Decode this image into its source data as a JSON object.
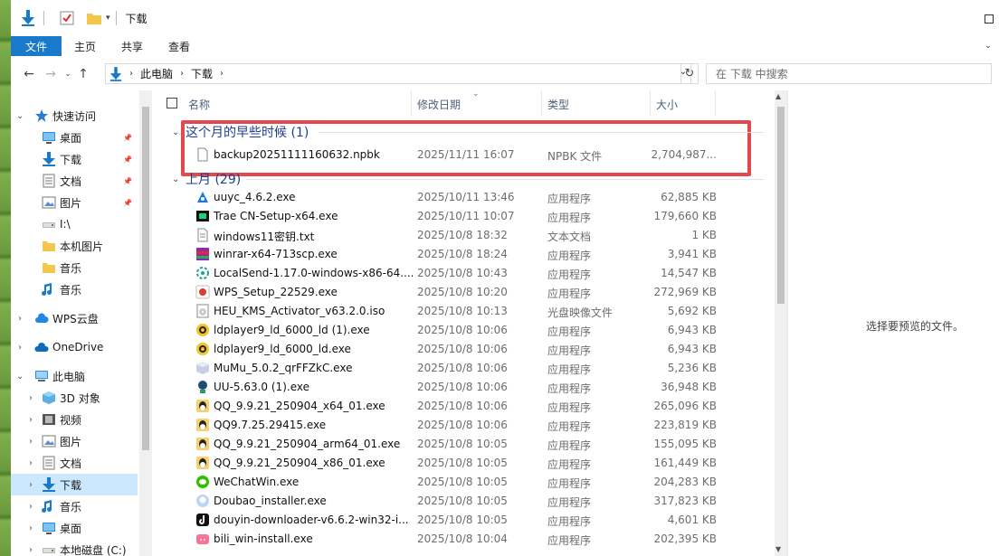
{
  "title": "下载",
  "ribbon": {
    "tabs": [
      "文件",
      "主页",
      "共享",
      "查看"
    ]
  },
  "address": {
    "crumbs": [
      "此电脑",
      "下载"
    ]
  },
  "search": {
    "placeholder": "在 下载 中搜索"
  },
  "nav": {
    "items": [
      {
        "label": "快速访问",
        "icon": "star-icon",
        "arrow": "expanded"
      },
      {
        "label": "桌面",
        "icon": "desktop-icon",
        "pinned": true
      },
      {
        "label": "下载",
        "icon": "download-arrow-icon",
        "pinned": true
      },
      {
        "label": "文档",
        "icon": "document-icon",
        "pinned": true
      },
      {
        "label": "图片",
        "icon": "picture-icon",
        "pinned": true
      },
      {
        "label": "I:\\",
        "icon": "drive-icon"
      },
      {
        "label": "本机图片",
        "icon": "folder-icon"
      },
      {
        "label": "音乐",
        "icon": "folder-icon"
      },
      {
        "label": "音乐",
        "icon": "music-icon"
      },
      {
        "label": "WPS云盘",
        "icon": "cloud-icon",
        "arrow": "collapsed"
      },
      {
        "label": "OneDrive",
        "icon": "onedrive-cloud-icon",
        "arrow": "collapsed"
      },
      {
        "label": "此电脑",
        "icon": "computer-icon",
        "arrow": "expanded"
      },
      {
        "label": "3D 对象",
        "icon": "cube-icon",
        "arrow": "collapsed"
      },
      {
        "label": "视频",
        "icon": "video-icon",
        "arrow": "collapsed"
      },
      {
        "label": "图片",
        "icon": "picture-icon",
        "arrow": "collapsed"
      },
      {
        "label": "文档",
        "icon": "document-icon",
        "arrow": "collapsed"
      },
      {
        "label": "下载",
        "icon": "download-arrow-icon",
        "arrow": "collapsed",
        "selected": true
      },
      {
        "label": "音乐",
        "icon": "music-icon",
        "arrow": "collapsed"
      },
      {
        "label": "桌面",
        "icon": "desktop-icon",
        "arrow": "collapsed"
      },
      {
        "label": "本地磁盘 (C:)",
        "icon": "drive-icon",
        "arrow": "collapsed"
      }
    ]
  },
  "columns": {
    "name": "名称",
    "date": "修改日期",
    "type": "类型",
    "size": "大小"
  },
  "groups": [
    {
      "label": "这个月的早些时候 (1)",
      "files": [
        {
          "name": "backup20251111160632.npbk",
          "date": "2025/11/11 16:07",
          "type": "NPBK 文件",
          "size": "2,704,987...",
          "icon": "blank-file-icon"
        }
      ]
    },
    {
      "label": "上月 (29)",
      "files": [
        {
          "name": "uuyc_4.6.2.exe",
          "date": "2025/10/11 13:46",
          "type": "应用程序",
          "size": "62,885 KB",
          "icon": "uuyc-app-icon"
        },
        {
          "name": "Trae CN-Setup-x64.exe",
          "date": "2025/10/11 10:07",
          "type": "应用程序",
          "size": "179,660 KB",
          "icon": "trae-app-icon"
        },
        {
          "name": "windows11密钥.txt",
          "date": "2025/10/8 18:32",
          "type": "文本文档",
          "size": "1 KB",
          "icon": "text-file-icon"
        },
        {
          "name": "winrar-x64-713scp.exe",
          "date": "2025/10/8 18:24",
          "type": "应用程序",
          "size": "3,941 KB",
          "icon": "winrar-icon"
        },
        {
          "name": "LocalSend-1.17.0-windows-x86-64....",
          "date": "2025/10/8 10:43",
          "type": "应用程序",
          "size": "14,547 KB",
          "icon": "localsend-icon"
        },
        {
          "name": "WPS_Setup_22529.exe",
          "date": "2025/10/8 10:20",
          "type": "应用程序",
          "size": "272,969 KB",
          "icon": "wps-setup-icon"
        },
        {
          "name": "HEU_KMS_Activator_v63.2.0.iso",
          "date": "2025/10/8 10:13",
          "type": "光盘映像文件",
          "size": "5,692 KB",
          "icon": "iso-disc-icon"
        },
        {
          "name": "ldplayer9_ld_6000_ld (1).exe",
          "date": "2025/10/8 10:06",
          "type": "应用程序",
          "size": "6,943 KB",
          "icon": "ldplayer-icon"
        },
        {
          "name": "ldplayer9_ld_6000_ld.exe",
          "date": "2025/10/8 10:06",
          "type": "应用程序",
          "size": "6,943 KB",
          "icon": "ldplayer-icon"
        },
        {
          "name": "MuMu_5.0.2_qrFFZkC.exe",
          "date": "2025/10/8 10:06",
          "type": "应用程序",
          "size": "5,236 KB",
          "icon": "mumu-icon"
        },
        {
          "name": "UU-5.63.0 (1).exe",
          "date": "2025/10/8 10:06",
          "type": "应用程序",
          "size": "36,948 KB",
          "icon": "uu-icon"
        },
        {
          "name": "QQ_9.9.21_250904_x64_01.exe",
          "date": "2025/10/8 10:06",
          "type": "应用程序",
          "size": "265,096 KB",
          "icon": "qq-icon"
        },
        {
          "name": "QQ9.7.25.29415.exe",
          "date": "2025/10/8 10:06",
          "type": "应用程序",
          "size": "223,819 KB",
          "icon": "qq-icon"
        },
        {
          "name": "QQ_9.9.21_250904_arm64_01.exe",
          "date": "2025/10/8 10:05",
          "type": "应用程序",
          "size": "155,095 KB",
          "icon": "qq-icon"
        },
        {
          "name": "QQ_9.9.21_250904_x86_01.exe",
          "date": "2025/10/8 10:05",
          "type": "应用程序",
          "size": "161,449 KB",
          "icon": "qq-icon"
        },
        {
          "name": "WeChatWin.exe",
          "date": "2025/10/8 10:05",
          "type": "应用程序",
          "size": "204,283 KB",
          "icon": "wechat-icon"
        },
        {
          "name": "Doubao_installer.exe",
          "date": "2025/10/8 10:05",
          "type": "应用程序",
          "size": "317,823 KB",
          "icon": "doubao-icon"
        },
        {
          "name": "douyin-downloader-v6.6.2-win32-i...",
          "date": "2025/10/8 10:05",
          "type": "应用程序",
          "size": "4,601 KB",
          "icon": "douyin-icon"
        },
        {
          "name": "bili_win-install.exe",
          "date": "2025/10/8 10:04",
          "type": "应用程序",
          "size": "202,395 KB",
          "icon": "bilibili-icon"
        }
      ]
    }
  ],
  "preview": {
    "text": "选择要预览的文件。"
  },
  "colors": {
    "accent": "#1979ca",
    "highlight": "#e4484f",
    "group": "#1c3f94",
    "selected": "#cce8ff"
  }
}
